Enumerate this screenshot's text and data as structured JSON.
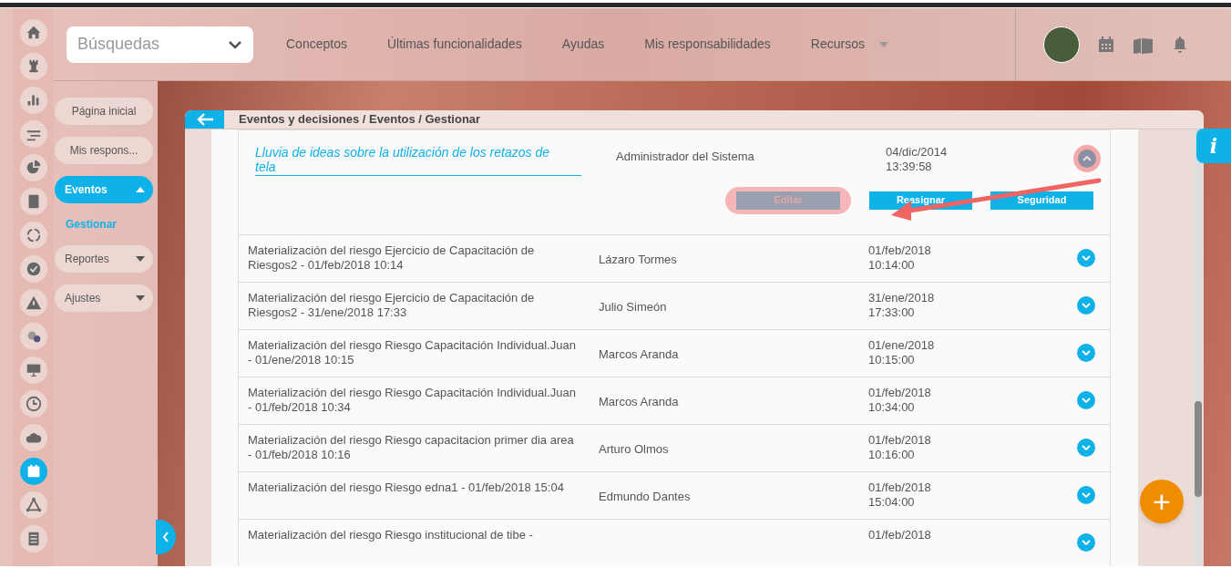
{
  "topbar": {
    "search": {
      "value": "Búsquedas"
    },
    "menu": [
      {
        "label": "Conceptos",
        "dropdown": false
      },
      {
        "label": "Últimas funcionalidades",
        "dropdown": false
      },
      {
        "label": "Ayudas",
        "dropdown": false
      },
      {
        "label": "Mis responsabilidades",
        "dropdown": false
      },
      {
        "label": "Recursos",
        "dropdown": true
      }
    ]
  },
  "rail": [
    {
      "selected": false
    },
    {
      "selected": false
    },
    {
      "selected": false
    },
    {
      "selected": false
    },
    {
      "selected": false
    },
    {
      "selected": false
    },
    {
      "selected": false
    },
    {
      "selected": false
    },
    {
      "selected": false
    },
    {
      "selected": false
    },
    {
      "selected": false
    },
    {
      "selected": false
    },
    {
      "selected": false
    },
    {
      "selected": true
    },
    {
      "selected": false
    },
    {
      "selected": false
    }
  ],
  "sidebar": {
    "items": [
      {
        "label": "Página inicial",
        "kind": "pill",
        "selected": false
      },
      {
        "label": "Mis respons...",
        "kind": "pill",
        "selected": false
      },
      {
        "label": "Eventos",
        "kind": "group",
        "selected": true,
        "expanded": true
      },
      {
        "label": "Gestionar",
        "kind": "link",
        "selected": true
      },
      {
        "label": "Reportes",
        "kind": "group",
        "selected": false,
        "expanded": false
      },
      {
        "label": "Ajustes",
        "kind": "group",
        "selected": false,
        "expanded": false
      }
    ]
  },
  "panel": {
    "breadcrumb": "Eventos y decisiones / Eventos / Gestionar",
    "rows": [
      {
        "title": "Lluvia de ideas sobre la utilización de los retazos de tela",
        "user": "Administrador del Sistema",
        "date": "04/dic/2014",
        "time": "13:39:58",
        "expanded": true,
        "actions": [
          {
            "label": "Editar",
            "disabled": true
          },
          {
            "label": "Reasignar",
            "disabled": false
          },
          {
            "label": "Seguridad",
            "disabled": false
          }
        ]
      },
      {
        "title": "Materialización del riesgo Ejercicio de Capacitación de Riesgos2 - 01/feb/2018 10:14",
        "user": "Lázaro Tormes",
        "date": "01/feb/2018",
        "time": "10:14:00",
        "expanded": false
      },
      {
        "title": "Materialización del riesgo Ejercicio de Capacitación de Riesgos2 - 31/ene/2018 17:33",
        "user": "Julio Simeón",
        "date": "31/ene/2018",
        "time": "17:33:00",
        "expanded": false
      },
      {
        "title": "Materialización del riesgo Riesgo Capacitación Individual.Juan - 01/ene/2018 10:15",
        "user": "Marcos Aranda",
        "date": "01/ene/2018",
        "time": "10:15:00",
        "expanded": false
      },
      {
        "title": "Materialización del riesgo Riesgo Capacitación Individual.Juan - 01/feb/2018 10:34",
        "user": "Marcos Aranda",
        "date": "01/feb/2018",
        "time": "10:34:00",
        "expanded": false
      },
      {
        "title": "Materialización del riesgo Riesgo capacitacion primer dia area - 01/feb/2018 10:16",
        "user": "Arturo Olmos",
        "date": "01/feb/2018",
        "time": "10:16:00",
        "expanded": false
      },
      {
        "title": "Materialización del riesgo Riesgo edna1 - 01/feb/2018 15:04",
        "user": "Edmundo Dantes",
        "date": "01/feb/2018",
        "time": "15:04:00",
        "expanded": false
      },
      {
        "title": "Materialización del riesgo Riesgo institucional de tibe -",
        "date": "01/feb/2018",
        "expanded": false
      }
    ]
  },
  "info_button": "i",
  "fab": "+"
}
